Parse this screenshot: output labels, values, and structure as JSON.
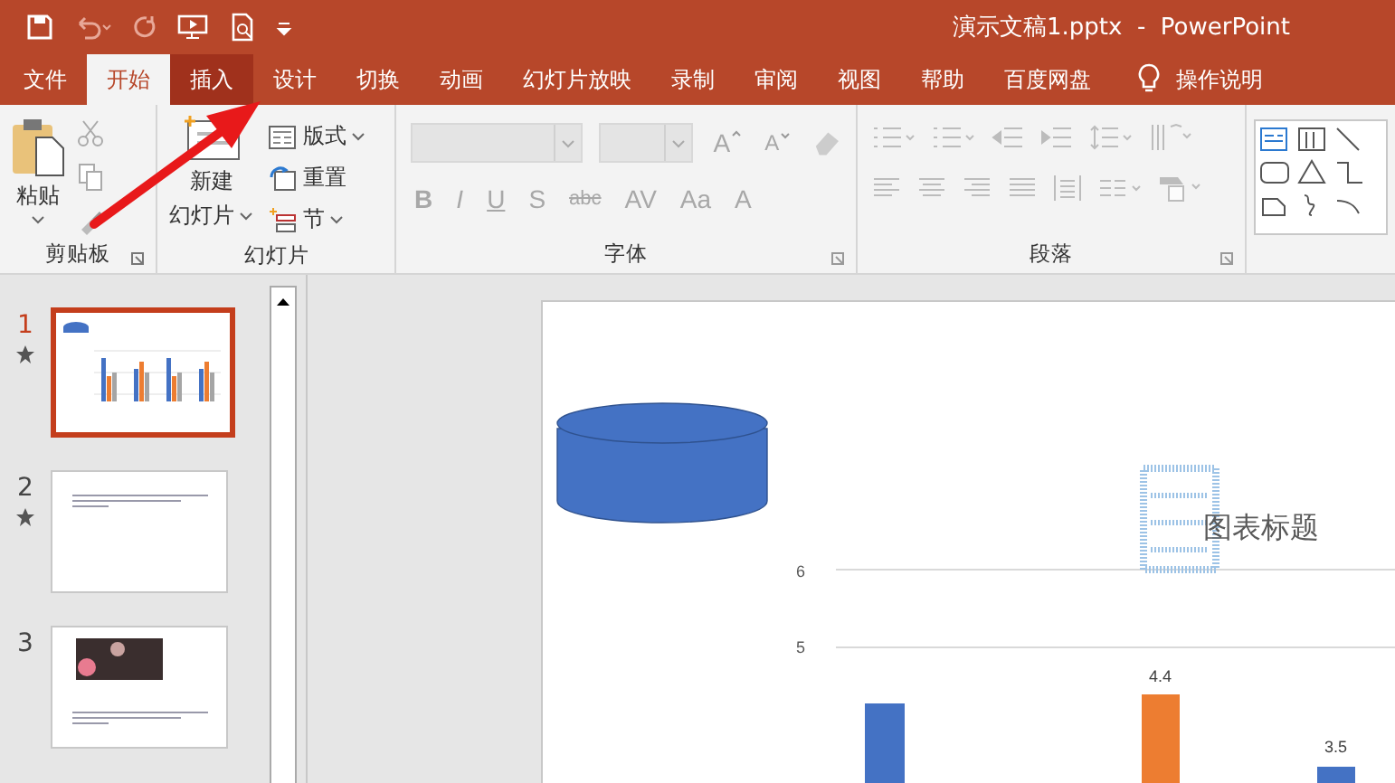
{
  "window": {
    "title": "演示文稿1.pptx  -  PowerPoint"
  },
  "tabs": [
    {
      "label": "文件",
      "selected": false,
      "hovered": false
    },
    {
      "label": "开始",
      "selected": true,
      "hovered": false
    },
    {
      "label": "插入",
      "selected": false,
      "hovered": true
    },
    {
      "label": "设计",
      "selected": false,
      "hovered": false
    },
    {
      "label": "切换",
      "selected": false,
      "hovered": false
    },
    {
      "label": "动画",
      "selected": false,
      "hovered": false
    },
    {
      "label": "幻灯片放映",
      "selected": false,
      "hovered": false
    },
    {
      "label": "录制",
      "selected": false,
      "hovered": false
    },
    {
      "label": "审阅",
      "selected": false,
      "hovered": false
    },
    {
      "label": "视图",
      "selected": false,
      "hovered": false
    },
    {
      "label": "帮助",
      "selected": false,
      "hovered": false
    },
    {
      "label": "百度网盘",
      "selected": false,
      "hovered": false
    }
  ],
  "tell_me": "操作说明",
  "ribbon": {
    "clipboard": {
      "label": "剪贴板",
      "paste": "粘贴"
    },
    "slides": {
      "label": "幻灯片",
      "new_slide": [
        "新建",
        "幻灯片"
      ],
      "layout": "版式",
      "reset": "重置",
      "section": "节"
    },
    "font": {
      "label": "字体",
      "disabled": true,
      "top_buttons": [
        "A",
        "A"
      ],
      "buttons": [
        "B",
        "I",
        "U",
        "S",
        "abc",
        "AV",
        "Aa",
        "A"
      ]
    },
    "paragraph": {
      "label": "段落",
      "disabled": true
    }
  },
  "slides": [
    {
      "number": "1",
      "selected": true,
      "starred": true,
      "kind": "chart"
    },
    {
      "number": "2",
      "selected": false,
      "starred": true,
      "kind": "text"
    },
    {
      "number": "3",
      "selected": false,
      "starred": false,
      "kind": "photo"
    }
  ],
  "canvas": {
    "chart_title": "图表标题",
    "axis_labels": [
      "6",
      "5"
    ],
    "data_labels": [
      "4.4",
      "3.5"
    ]
  },
  "annotation": {
    "arrow": true
  }
}
